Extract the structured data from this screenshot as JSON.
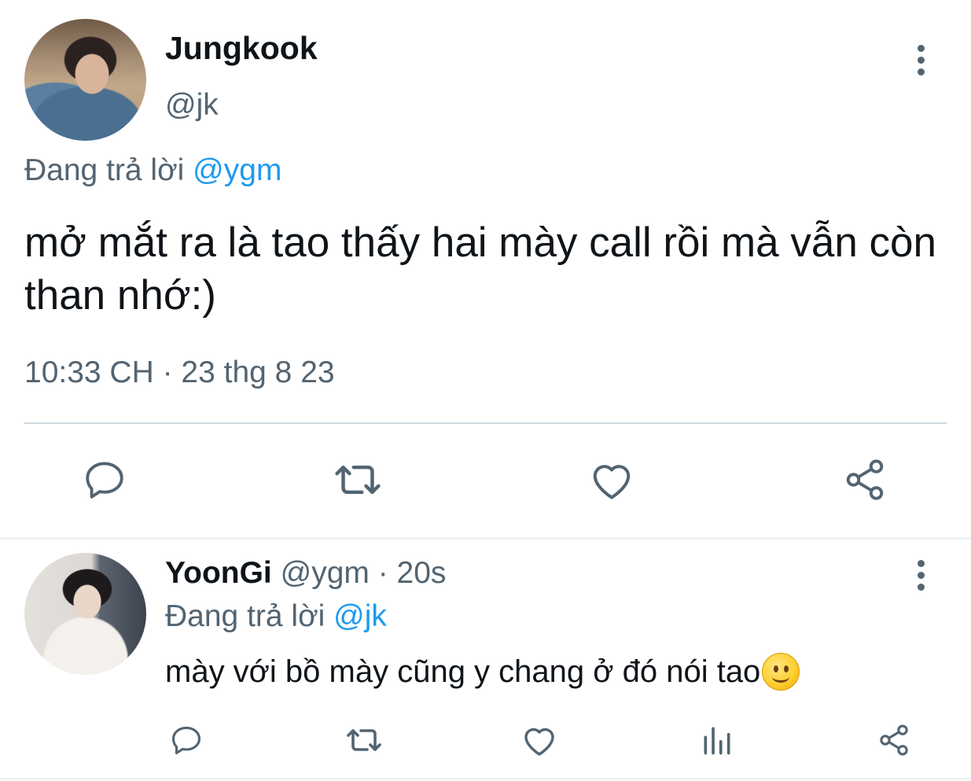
{
  "tweet": {
    "author_name": "Jungkook",
    "author_handle": "@jk",
    "reply_prefix": "Đang trả lời ",
    "reply_to": "@ygm",
    "text": "mở mắt ra là tao thấy hai mày call rồi mà vẫn còn than nhớ:)",
    "timestamp": "10:33 CH · 23 thg 8 23",
    "actions": [
      "reply-icon",
      "retweet-icon",
      "like-icon",
      "share-icon"
    ]
  },
  "reply": {
    "author_name": "YoonGi",
    "meta": " @ygm · 20s",
    "reply_prefix": "Đang trả lời ",
    "reply_to": "@jk",
    "text": "mày với bồ mày cũng y chang ở đó nói tao",
    "emoji": "slightly-smiling-face",
    "actions": [
      "reply-icon",
      "retweet-icon",
      "like-icon",
      "analytics-icon",
      "share-icon"
    ]
  },
  "colors": {
    "text_primary": "#0f1419",
    "text_secondary": "#536471",
    "accent": "#1d9bf0",
    "divider": "#cfd9de"
  }
}
